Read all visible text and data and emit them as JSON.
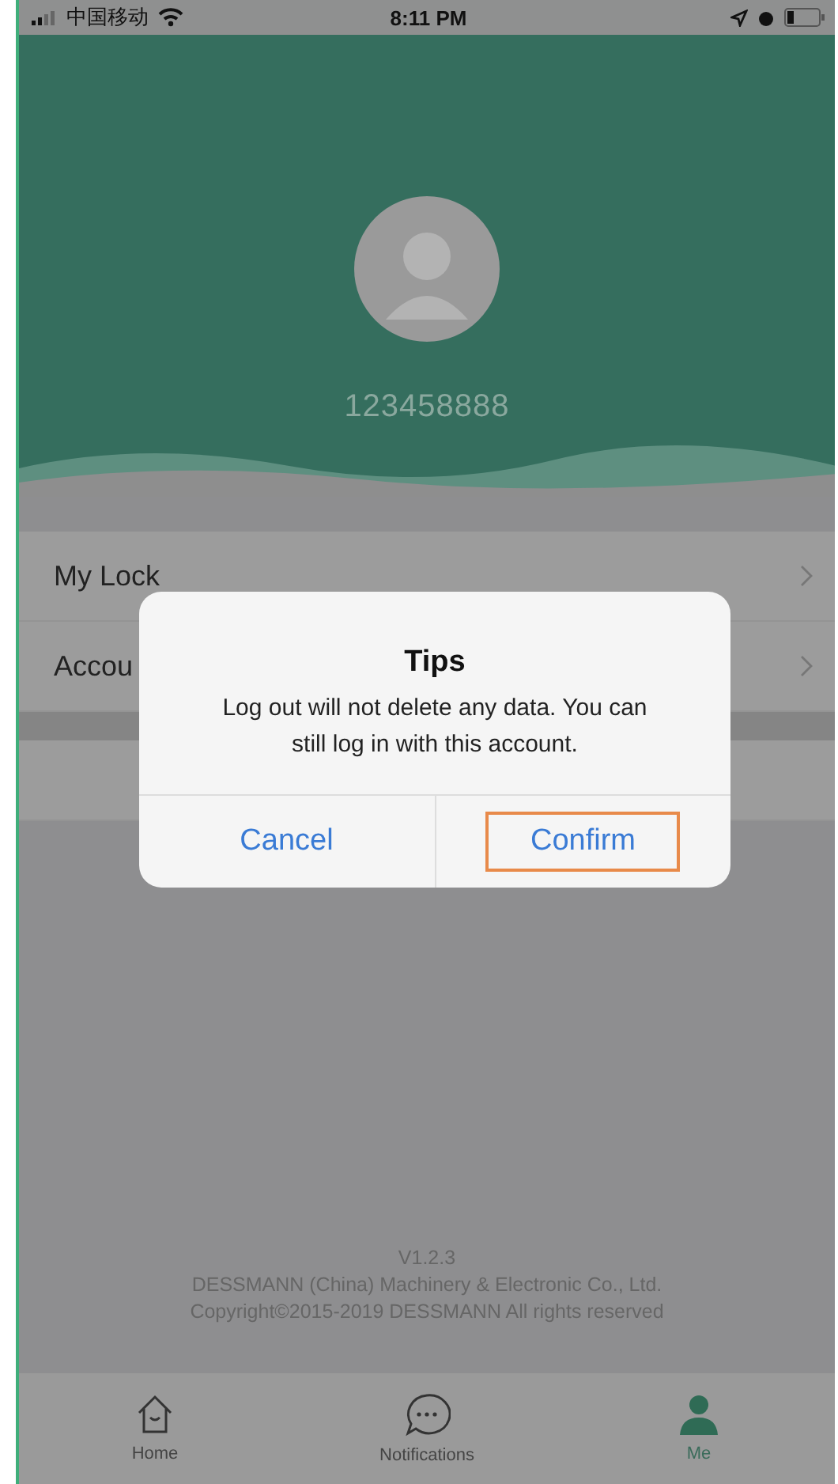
{
  "status_bar": {
    "carrier": "中国移动",
    "time": "8:11 PM"
  },
  "profile": {
    "account": "123458888"
  },
  "menu": [
    {
      "label": "My Lock"
    },
    {
      "label": "Accou"
    }
  ],
  "dialog": {
    "title": "Tips",
    "message": "Log out will not delete any data. You can still log in with this account.",
    "buttons": [
      {
        "label": "Cancel",
        "selected": false
      },
      {
        "label": "Confirm",
        "selected": true
      }
    ]
  },
  "footer": {
    "version": "V1.2.3",
    "company": "DESSMANN (China) Machinery & Electronic Co., Ltd.",
    "copyright": "Copyright©2015-2019 DESSMANN All rights reserved"
  },
  "tabs": [
    {
      "label": "Home",
      "kind": "home",
      "selected": false
    },
    {
      "label": "Notifications",
      "kind": "chat",
      "selected": false
    },
    {
      "label": "Me",
      "kind": "person",
      "selected": true
    }
  ]
}
